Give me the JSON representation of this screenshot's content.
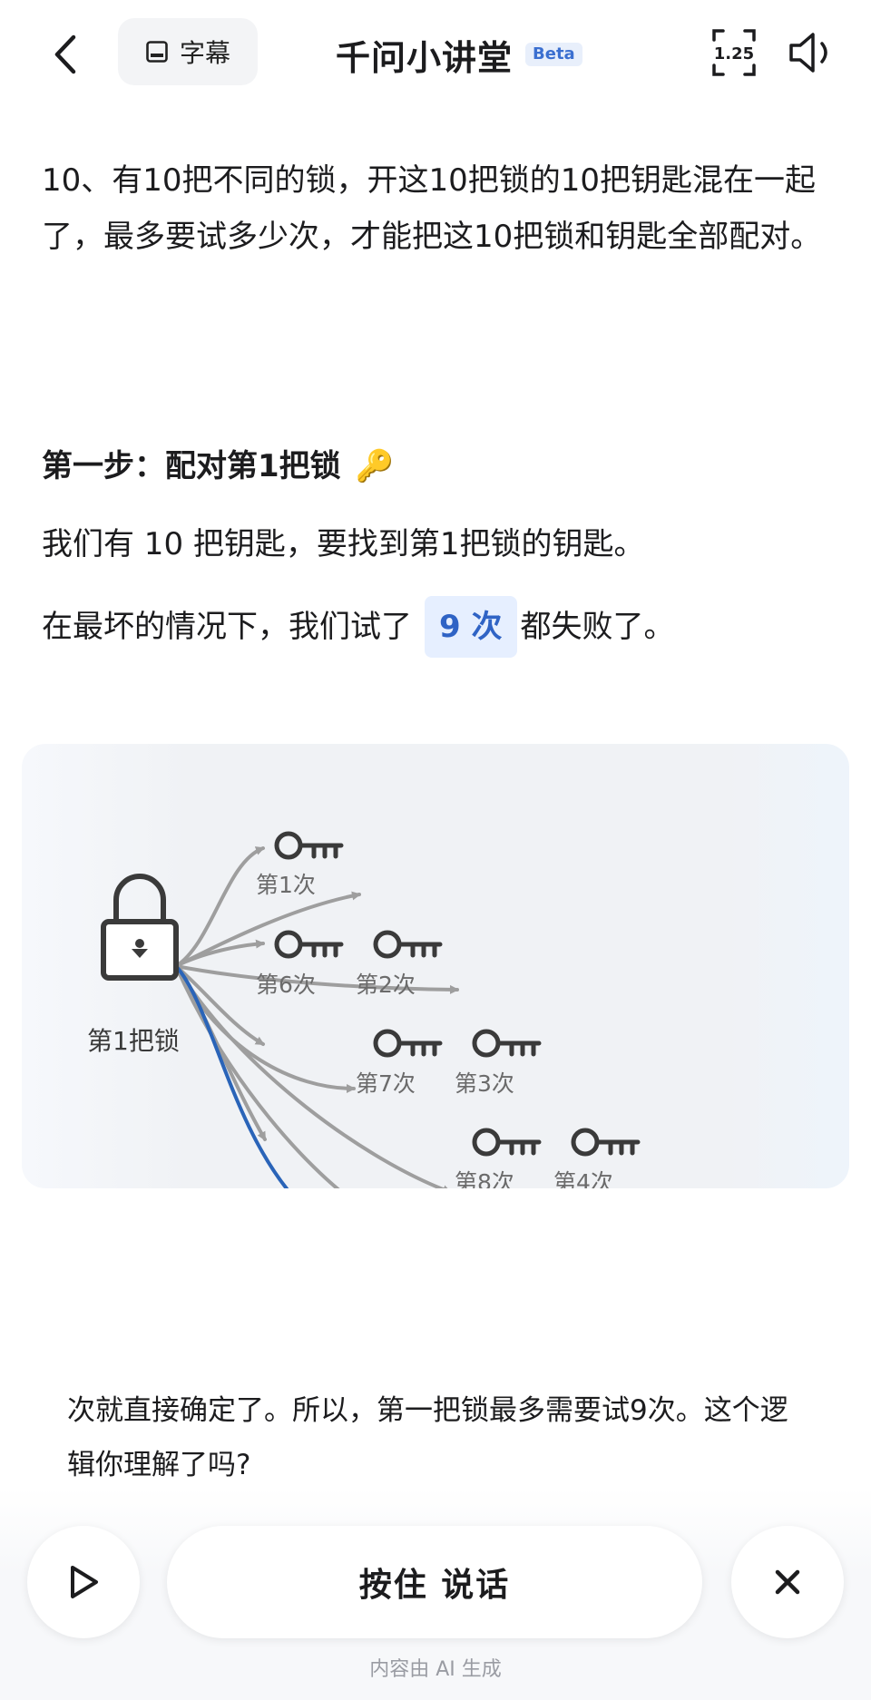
{
  "header": {
    "subtitle_label": "字幕",
    "title": "千问小讲堂",
    "beta": "Beta",
    "speed": "1.25"
  },
  "content": {
    "question": "10、有10把不同的锁，开这10把锁的10把钥匙混在一起了，最多要试多少次，才能把这10把锁和钥匙全部配对。",
    "step_title": "第一步：配对第1把锁",
    "step_emoji": "🔑",
    "p1": "我们有 10 把钥匙，要找到第1把锁的钥匙。",
    "p2_before": "在最坏的情况下，我们试了",
    "p2_highlight": "9 次",
    "p2_after": "都失败了。"
  },
  "diagram": {
    "lock_label": "第1把锁",
    "attempt_labels": [
      "第1次",
      "第6次",
      "第2次",
      "第7次",
      "第3次",
      "第8次",
      "第4次"
    ]
  },
  "answer": "次就直接确定了。所以，第一把锁最多需要试9次。这个逻辑你理解了吗?",
  "bottom": {
    "hold_to_talk": "按住 说话",
    "footnote": "内容由 AI 生成"
  },
  "colors": {
    "accent": "#2f63c5",
    "highlight_bg": "#e6efff",
    "arrow_gray": "#9e9e9e",
    "arrow_blue": "#2a64b8"
  }
}
